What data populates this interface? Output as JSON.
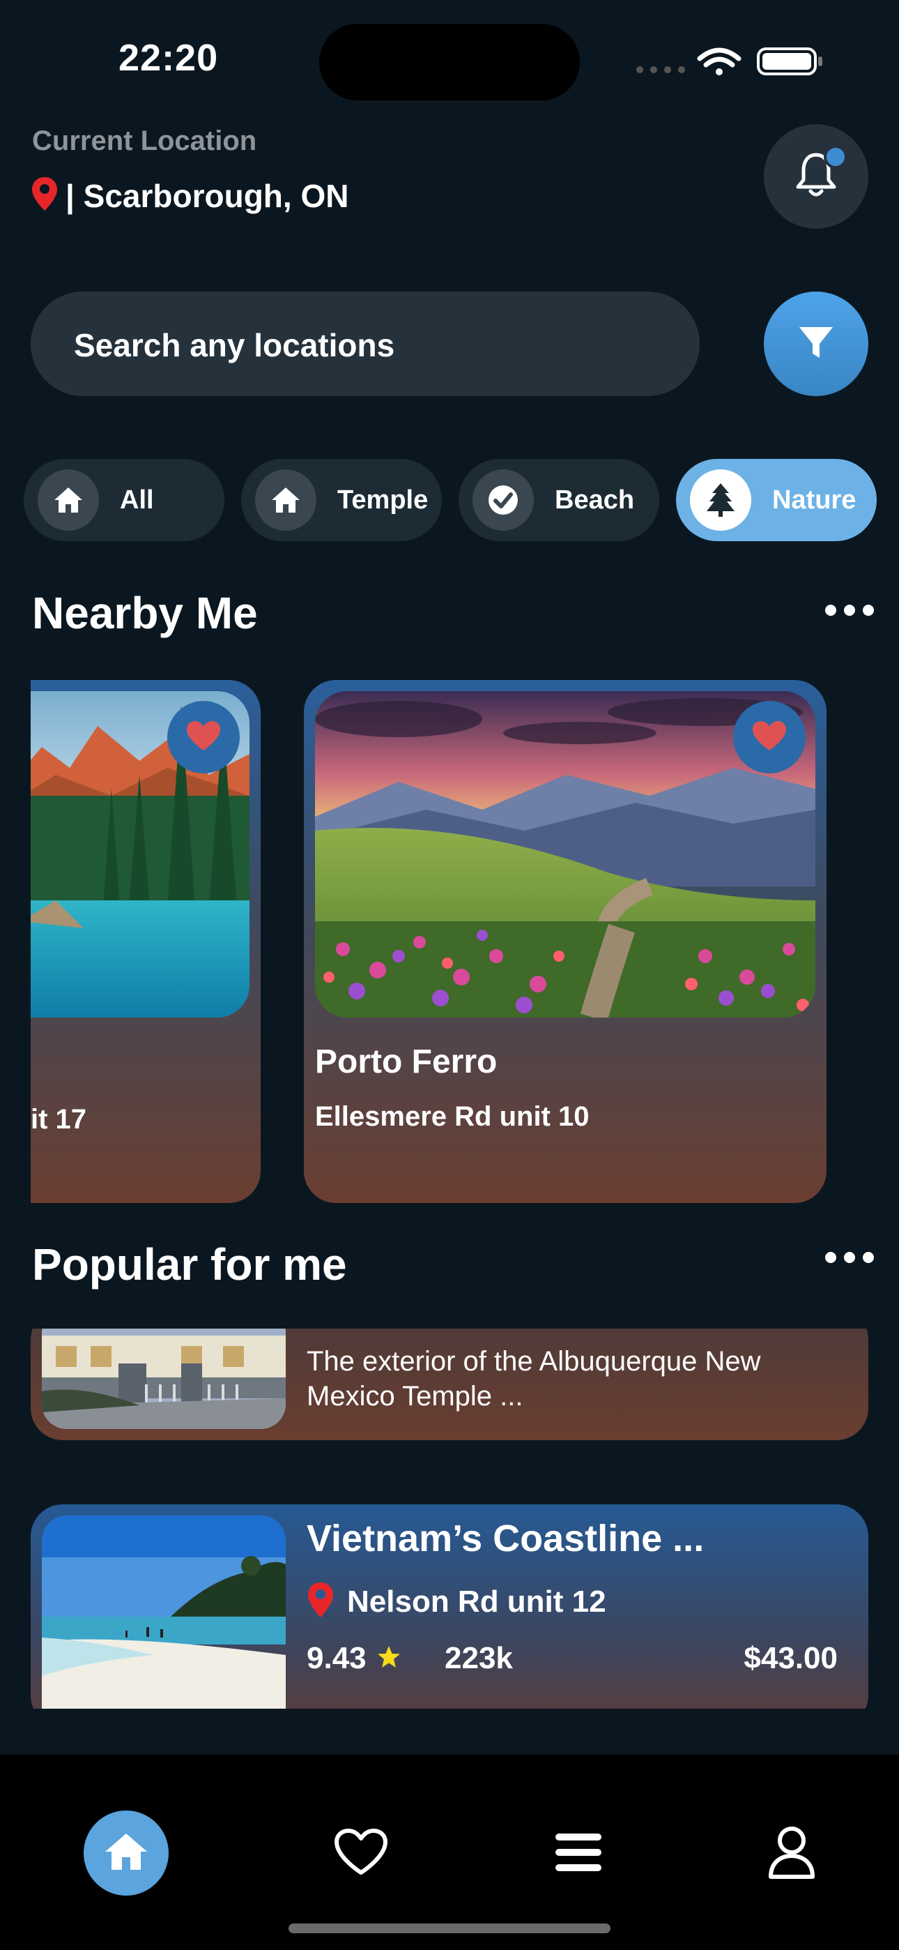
{
  "status_bar": {
    "time": "22:20"
  },
  "header": {
    "location_label": "Current Location",
    "location_value": "| Scarborough, ON"
  },
  "search": {
    "placeholder": "Search any locations"
  },
  "categories": [
    {
      "label": "All",
      "icon": "home-icon",
      "active": false
    },
    {
      "label": "Temple",
      "icon": "home-icon",
      "active": false
    },
    {
      "label": "Beach",
      "icon": "check-circle-icon",
      "active": false
    },
    {
      "label": "Nature",
      "icon": "tree-icon",
      "active": true
    }
  ],
  "nearby": {
    "title": "Nearby Me",
    "cards": [
      {
        "title": "",
        "address": "it 17",
        "favorited": true
      },
      {
        "title": "Porto Ferro",
        "address": "Ellesmere Rd unit 10",
        "favorited": true
      }
    ]
  },
  "popular": {
    "title": "Popular for me",
    "items": [
      {
        "text": "The exterior of the Albuquerque New Mexico Temple ..."
      },
      {
        "title": "Vietnam’s Coastline ...",
        "address": "Nelson Rd unit 12",
        "rating": "9.43",
        "views": "223k",
        "price": "$43.00"
      }
    ]
  },
  "bottom_nav": [
    {
      "name": "home-icon",
      "active": true
    },
    {
      "name": "heart-icon",
      "active": false
    },
    {
      "name": "menu-icon",
      "active": false
    },
    {
      "name": "user-icon",
      "active": false
    }
  ],
  "colors": {
    "background": "#0b1720",
    "accent": "#5ba4dd",
    "heart": "#e05252",
    "pin": "#e8262a",
    "star": "#f5dc1a"
  }
}
